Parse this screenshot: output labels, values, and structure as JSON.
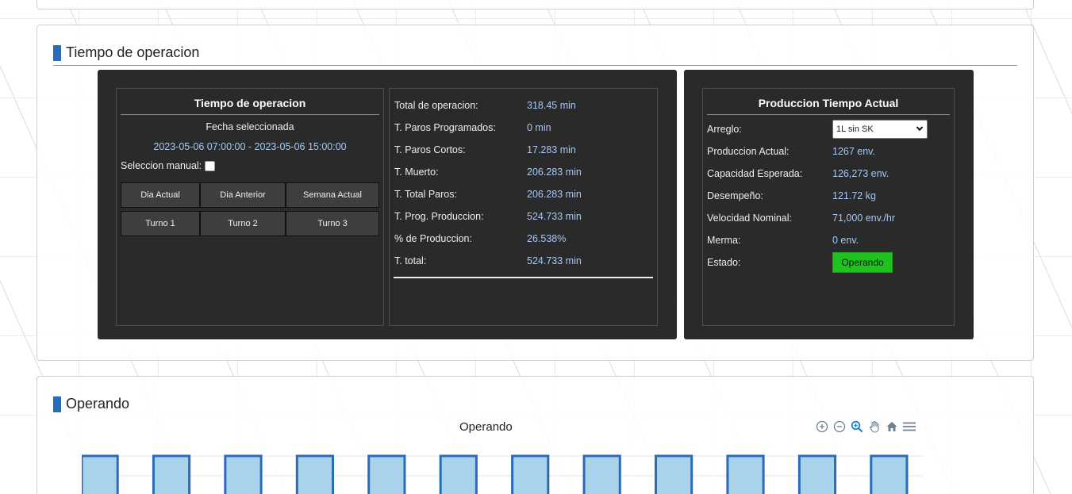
{
  "tiempo_section": {
    "title": "Tiempo de operacion",
    "left_panel": {
      "title": "Tiempo de operacion",
      "fecha_label": "Fecha seleccionada",
      "date_range": "2023-05-06 07:00:00 - 2023-05-06 15:00:00",
      "manual_label": "Seleccion manual:",
      "manual_checked": false,
      "buttons": [
        "Dia Actual",
        "Dia Anterior",
        "Semana Actual",
        "Turno 1",
        "Turno 2",
        "Turno 3"
      ]
    },
    "summary": [
      {
        "label": "Total de operacion:",
        "value": "318.45 min"
      },
      {
        "label": "T. Paros Programados:",
        "value": "0 min"
      },
      {
        "label": "T. Paros Cortos:",
        "value": "17.283 min"
      },
      {
        "label": "T. Muerto:",
        "value": "206.283 min"
      },
      {
        "label": "T. Total Paros:",
        "value": "206.283 min"
      },
      {
        "label": "T. Prog. Produccion:",
        "value": "524.733 min"
      },
      {
        "label": "% de Produccion:",
        "value": "26.538%"
      },
      {
        "label": "T. total:",
        "value": "524.733 min"
      }
    ],
    "produccion": {
      "title": "Produccion Tiempo Actual",
      "arreglo_label": "Arreglo:",
      "arreglo_value": "1L sin SK",
      "rows": [
        {
          "label": "Produccion Actual:",
          "value": "1267 env."
        },
        {
          "label": "Capacidad Esperada:",
          "value": "126,273 env."
        },
        {
          "label": "Desempeño:",
          "value": "121.72 kg"
        },
        {
          "label": "Velocidad Nominal:",
          "value": "71,000 env./hr"
        },
        {
          "label": "Merma:",
          "value": "0 env."
        }
      ],
      "estado_label": "Estado:",
      "estado_value": "Operando",
      "estado_color": "#1ec31e"
    }
  },
  "operando_section": {
    "title": "Operando",
    "chart_title": "Operando",
    "toolbar_icons": [
      "zoom-in-icon",
      "zoom-out-icon",
      "magnify-icon",
      "pan-hand-icon",
      "home-icon",
      "menu-icon"
    ]
  },
  "chart_data": {
    "type": "area",
    "title": "Operando",
    "series": [
      {
        "values": [
          1,
          0,
          1,
          0,
          1,
          0,
          1,
          0,
          1,
          0,
          1,
          0,
          1,
          0,
          1,
          0,
          1,
          0,
          1,
          0,
          1,
          0,
          1
        ]
      }
    ],
    "colors": {
      "line": "#2b6cb8",
      "fill": "#a8d3ea"
    }
  }
}
